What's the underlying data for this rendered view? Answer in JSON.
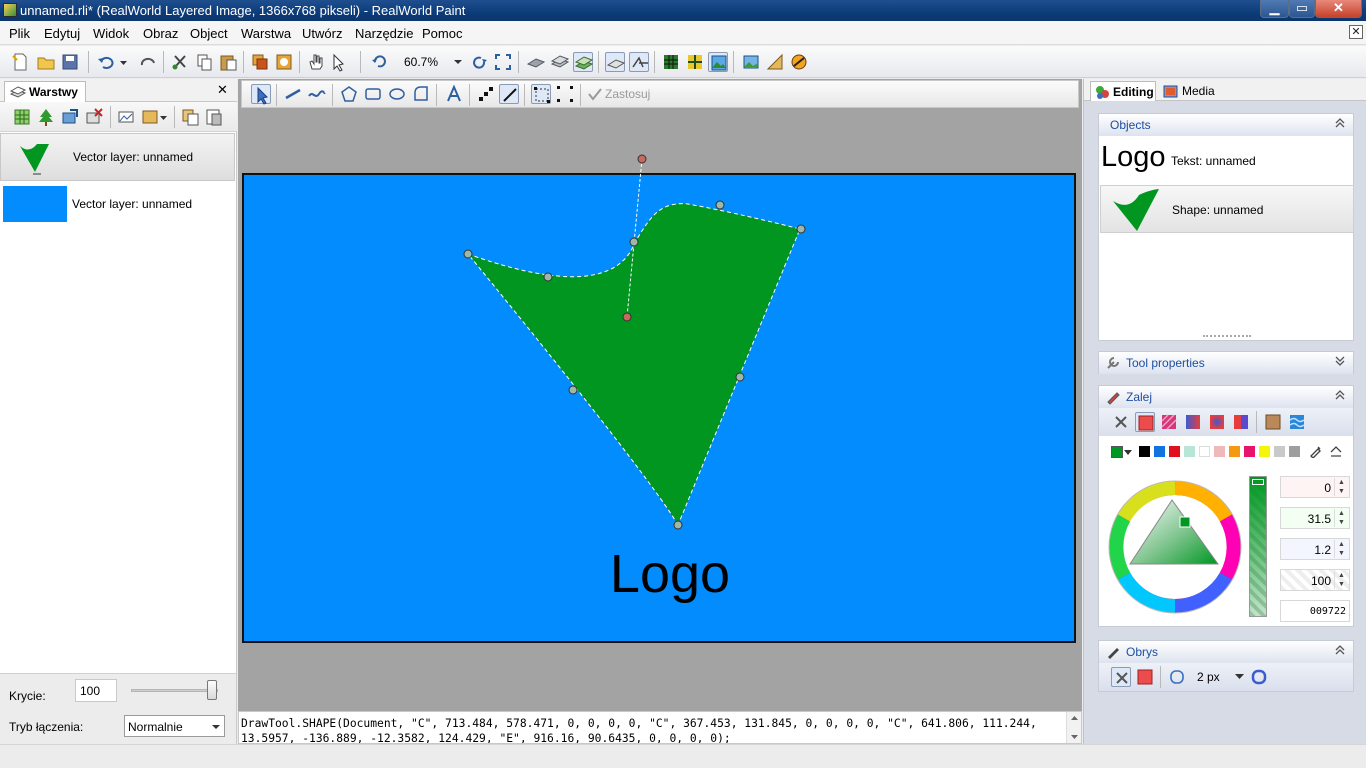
{
  "window": {
    "title": "unnamed.rli* (RealWorld Layered Image, 1366x768 pikseli) - RealWorld Paint",
    "min_symbol": "▁",
    "max_symbol": "▭",
    "close_symbol": "✕"
  },
  "menu": [
    "Plik",
    "Edytuj",
    "Widok",
    "Obraz",
    "Object",
    "Warstwa",
    "Utwórz",
    "Narzędzie",
    "Pomoc"
  ],
  "toolbar": {
    "zoom": "60.7%"
  },
  "toolbar2": {
    "apply_label": "Zastosuj"
  },
  "layers_panel": {
    "tab_label": "Warstwy",
    "close_symbol": "✕",
    "layers": [
      {
        "label": "Vector layer: unnamed"
      },
      {
        "label": "Vector layer: unnamed"
      }
    ],
    "opacity_label": "Krycie:",
    "opacity_value": "100",
    "blend_label": "Tryb łączenia:",
    "blend_value": "Normalnie"
  },
  "canvas": {
    "text": "Logo",
    "background_color": "#028CFD",
    "shape_color": "#00961F"
  },
  "status_line": "DrawTool.SHAPE(Document, \"C\", 713.484, 578.471, 0, 0, 0, 0, \"C\", 367.453, 131.845, 0, 0, 0, 0, \"C\", 641.806, 111.244,\n13.5957, -136.889, -12.3582, 124.429, \"E\", 916.16, 90.6435, 0, 0, 0, 0);",
  "right_panel": {
    "tabs": [
      {
        "label": "Editing"
      },
      {
        "label": "Media"
      }
    ],
    "objects": {
      "title": "Objects",
      "items": [
        {
          "thumb_text": "Logo",
          "label": "Tekst: unnamed"
        },
        {
          "label": "Shape: unnamed"
        }
      ]
    },
    "tool_properties": {
      "title": "Tool properties"
    },
    "fill": {
      "title": "Zalej",
      "values": [
        "0",
        "31.5",
        "1.2",
        "100"
      ],
      "hex": "009722"
    },
    "outline": {
      "title": "Obrys",
      "width": "2 px"
    }
  }
}
